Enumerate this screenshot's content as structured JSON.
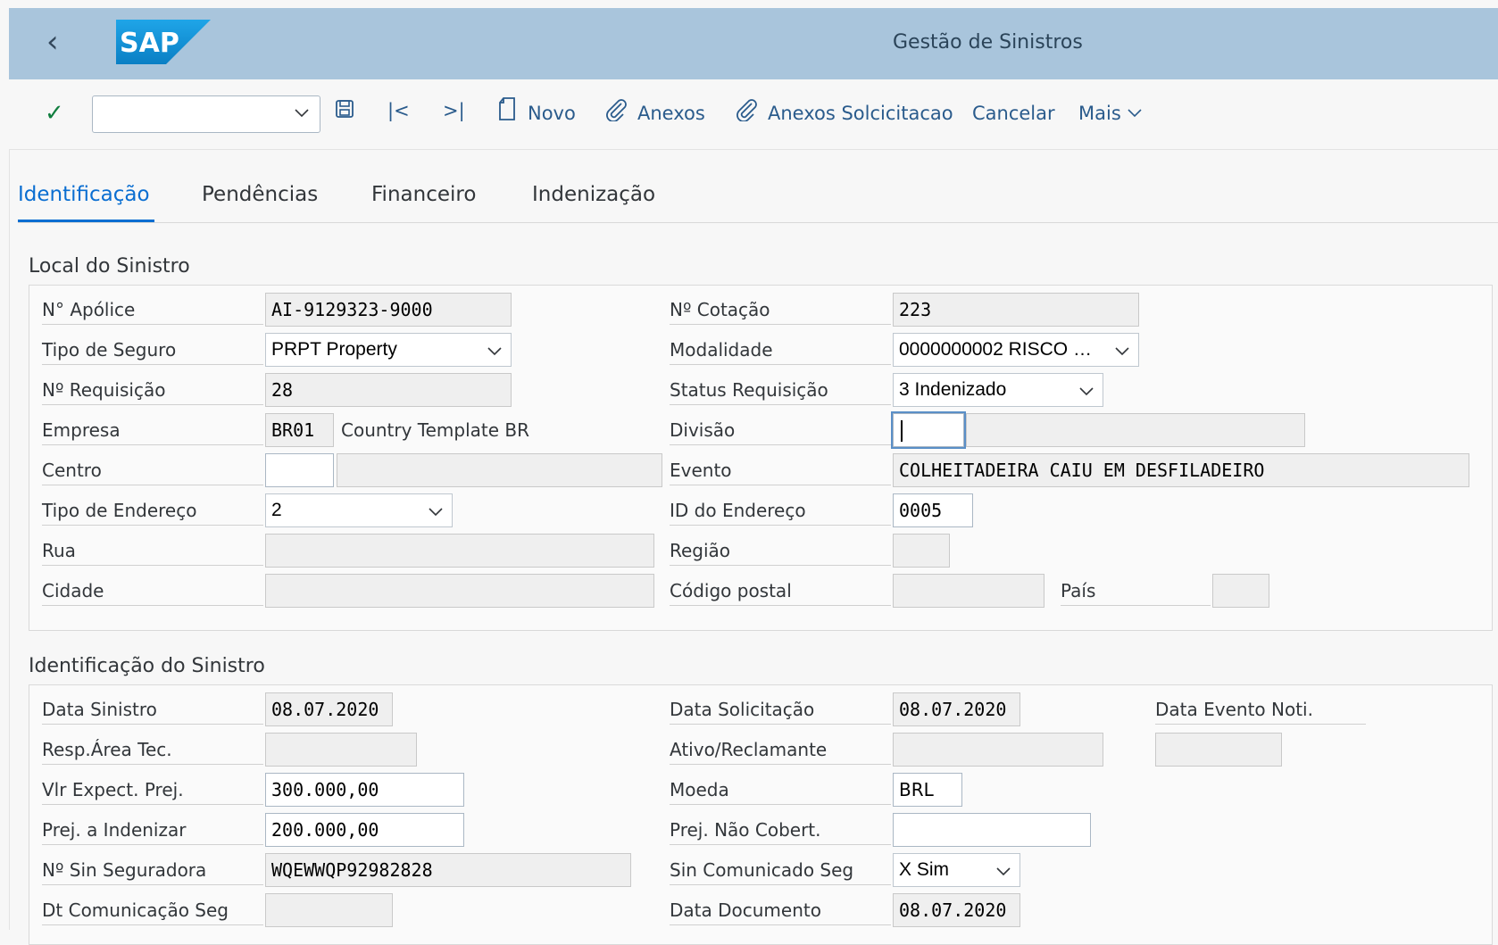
{
  "shell": {
    "title": "Gestão de Sinistros",
    "logo_text": "SAP"
  },
  "toolbar": {
    "command_value": "",
    "novo_label": "Novo",
    "anexos_label": "Anexos",
    "anexos_solic_label": "Anexos Solcicitacao",
    "cancelar_label": "Cancelar",
    "mais_label": "Mais"
  },
  "tabs": [
    {
      "label": "Identificação"
    },
    {
      "label": "Pendências"
    },
    {
      "label": "Financeiro"
    },
    {
      "label": "Indenização"
    }
  ],
  "local": {
    "title": "Local do Sinistro",
    "apolice_label": "N° Apólice",
    "apolice_value": "AI-9129323-9000",
    "cotacao_label": "Nº Cotação",
    "cotacao_value": "223",
    "tipo_seguro_label": "Tipo de Seguro",
    "tipo_seguro_value": "PRPT Property",
    "modalidade_label": "Modalidade",
    "modalidade_value": "0000000002 RISCO …",
    "requisicao_label": "Nº Requisição",
    "requisicao_value": "28",
    "status_label": "Status Requisição",
    "status_value": "3 Indenizado",
    "empresa_label": "Empresa",
    "empresa_value": "BR01",
    "empresa_desc": "Country Template BR",
    "divisao_label": "Divisão",
    "divisao_value": "",
    "centro_label": "Centro",
    "centro_value": "",
    "evento_label": "Evento",
    "evento_value": "COLHEITADEIRA CAIU EM DESFILADEIRO",
    "tipo_end_label": "Tipo de Endereço",
    "tipo_end_value": "2",
    "id_end_label": "ID do Endereço",
    "id_end_value": "0005",
    "rua_label": "Rua",
    "rua_value": "",
    "regiao_label": "Região",
    "regiao_value": "",
    "cidade_label": "Cidade",
    "cidade_value": "",
    "cep_label": "Código postal",
    "cep_value": "",
    "pais_label": "País",
    "pais_value": ""
  },
  "ident": {
    "title": "Identificação do Sinistro",
    "data_sinistro_label": "Data Sinistro",
    "data_sinistro_value": "08.07.2020",
    "data_solic_label": "Data Solicitação",
    "data_solic_value": "08.07.2020",
    "data_evento_label": "Data Evento Noti.",
    "data_evento_value": "",
    "resp_label": "Resp.Área Tec.",
    "resp_value": "",
    "ativo_label": "Ativo/Reclamante",
    "ativo_value": "",
    "vlr_label": "Vlr Expect. Prej.",
    "vlr_value": "300.000,00",
    "moeda_label": "Moeda",
    "moeda_value": "BRL",
    "prej_ind_label": "Prej. a Indenizar",
    "prej_ind_value": "200.000,00",
    "prej_nao_label": "Prej. Não Cobert.",
    "prej_nao_value": "",
    "sin_seg_label": "Nº Sin Seguradora",
    "sin_seg_value": "WQEWWQP92982828",
    "sin_com_label": "Sin Comunicado Seg",
    "sin_com_value": "X Sim",
    "dt_com_label": "Dt Comunicação Seg",
    "dt_com_value": "",
    "data_doc_label": "Data Documento",
    "data_doc_value": "08.07.2020"
  },
  "colors": {
    "shell_bg": "#a9c5dc",
    "accent": "#0a6ed1",
    "ok_green": "#107e3e"
  }
}
